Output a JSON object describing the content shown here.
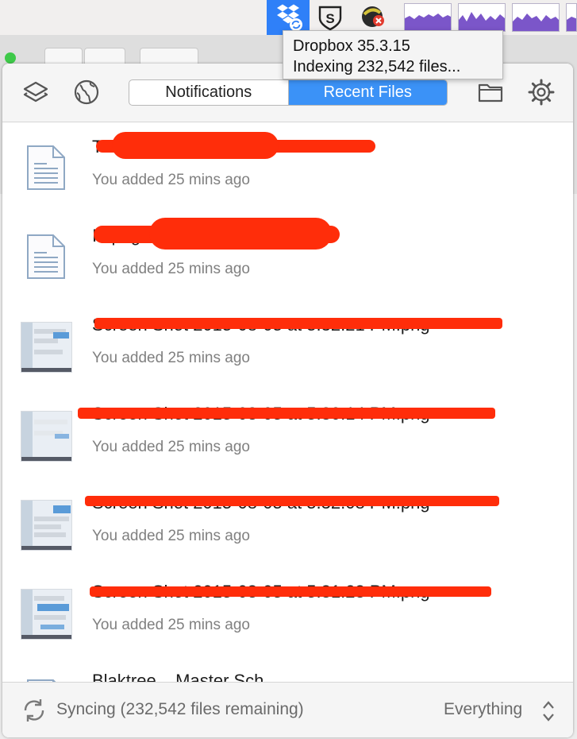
{
  "menubar": {
    "items": [
      {
        "name": "dropbox-menubar-icon"
      },
      {
        "name": "shield-s-menubar-icon",
        "glyph": "S"
      },
      {
        "name": "ball-error-menubar-icon"
      }
    ],
    "graph_count": 4,
    "accent": "#2f80f8"
  },
  "tooltip": {
    "line1": "Dropbox 35.3.15",
    "line2": "Indexing 232,542 files..."
  },
  "header": {
    "tabs": [
      {
        "label": "Notifications",
        "active": false
      },
      {
        "label": "Recent Files",
        "active": true
      }
    ],
    "icons": [
      "layers-icon",
      "globe-icon",
      "folder-icon",
      "gear-icon"
    ]
  },
  "files": [
    {
      "name": "Th...pages",
      "meta": "You added 25 mins ago",
      "kind": "document",
      "redacted": true
    },
    {
      "name": "I...page",
      "meta": "You added 25 mins ago",
      "kind": "document",
      "redacted": true
    },
    {
      "name": "Screen Shot 2015-08-05 at 5.32.21 PM.png",
      "meta": "You added 25 mins ago",
      "kind": "image",
      "redacted": true
    },
    {
      "name": "Screen Shot 2015-08-05 at 5.30.14 PM.png",
      "meta": "You added 25 mins ago",
      "kind": "image",
      "redacted": true
    },
    {
      "name": "Screen Shot 2015-08-05 at 5.32.08 PM.png",
      "meta": "You added 25 mins ago",
      "kind": "image",
      "redacted": true
    },
    {
      "name": "Screen Shot 2015-08-05 at 5.31.23 PM.png",
      "meta": "You added 25 mins ago",
      "kind": "image",
      "redacted": true
    },
    {
      "name": "Blaktree... Master Sch...",
      "meta": "",
      "kind": "document",
      "redacted": false
    }
  ],
  "footer": {
    "status": "Syncing (232,542 files remaining)",
    "filter": "Everything"
  },
  "colors": {
    "redaction": "#ff2d0a",
    "tab_active": "#3b92f7"
  }
}
